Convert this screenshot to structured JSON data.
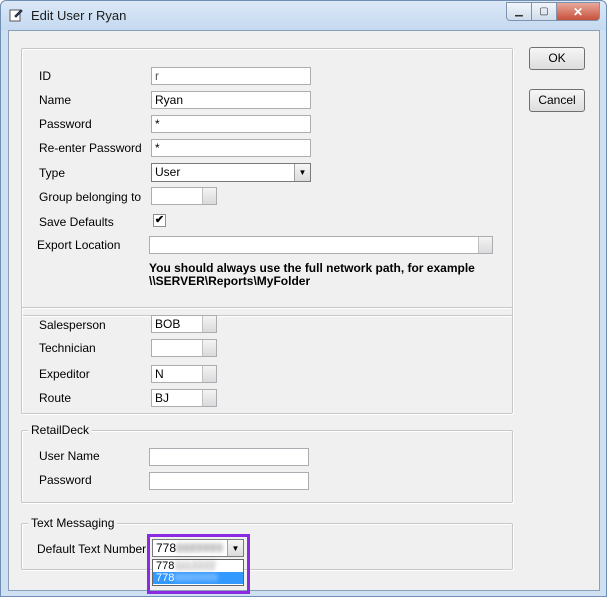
{
  "window": {
    "title": "Edit User r Ryan"
  },
  "user_section": {
    "id_label": "ID",
    "id_value": "r",
    "name_label": "Name",
    "name_value": "Ryan",
    "password_label": "Password",
    "password_value": "*",
    "reenter_label": "Re-enter Password",
    "reenter_value": "*",
    "type_label": "Type",
    "type_value": "User",
    "group_label": "Group belonging to",
    "group_value": "",
    "save_defaults_label": "Save Defaults",
    "save_defaults_checked": true,
    "checkmark": "✔",
    "export_label": "Export Location",
    "export_value": "",
    "note_line1": "You should always use the full network path, for example",
    "note_line2": "\\\\SERVER\\Reports\\MyFolder"
  },
  "assignments": {
    "salesperson_label": "Salesperson",
    "salesperson_value": "BOB",
    "technician_label": "Technician",
    "technician_value": "",
    "expeditor_label": "Expeditor",
    "expeditor_value": "N",
    "route_label": "Route",
    "route_value": "BJ"
  },
  "retaildeck": {
    "legend": "RetailDeck",
    "username_label": "User Name",
    "username_value": "",
    "password_label": "Password",
    "password_value": ""
  },
  "text_messaging": {
    "legend": "Text Messaging",
    "default_label": "Default Text Number",
    "selected_prefix": "778",
    "options": [
      {
        "prefix": "778",
        "rest": "1112222"
      },
      {
        "prefix": "778",
        "rest": "8889999"
      }
    ],
    "selected_index": 1
  },
  "buttons": {
    "ok": "OK",
    "cancel": "Cancel"
  },
  "icons": {
    "app": "edit-user-icon",
    "dropdown": "chevron-down-icon"
  },
  "colors": {
    "highlight": "#8a2be2",
    "selection": "#3399ff"
  }
}
